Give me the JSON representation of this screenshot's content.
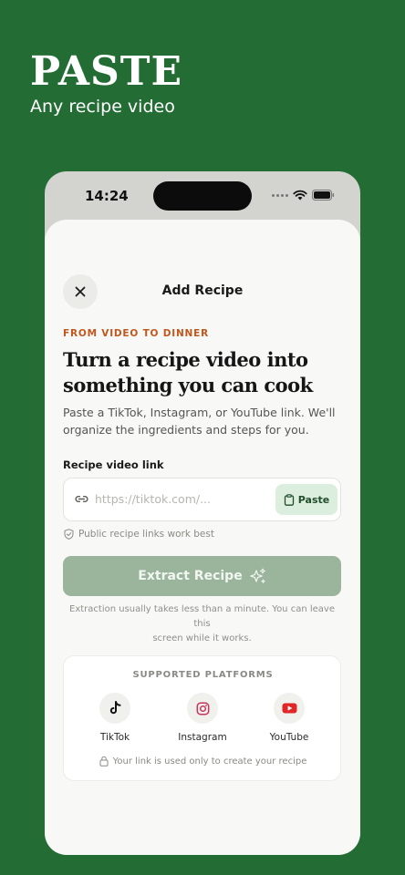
{
  "promo": {
    "title": "PASTE",
    "subtitle": "Any recipe video"
  },
  "status_bar": {
    "time": "14:24",
    "icons": [
      "signal-dots-icon",
      "wifi-icon",
      "battery-icon"
    ]
  },
  "sheet": {
    "title": "Add Recipe",
    "close_icon": "close-icon"
  },
  "intro": {
    "eyebrow": "FROM VIDEO TO DINNER",
    "headline_line1": "Turn a recipe video into",
    "headline_line2": "something you can cook",
    "body_line1": "Paste a TikTok, Instagram, or YouTube link. We'll",
    "body_line2": "organize the ingredients and steps for you."
  },
  "form": {
    "label": "Recipe video link",
    "placeholder": "https://tiktok.com/...",
    "value": "",
    "paste_label": "Paste",
    "hint": "Public recipe links work best",
    "extract_label": "Extract Recipe",
    "note_line1": "Extraction usually takes less than a minute. You can leave this",
    "note_line2": "screen while it works."
  },
  "platforms": {
    "title": "SUPPORTED PLATFORMS",
    "items": [
      {
        "label": "TikTok",
        "icon": "tiktok-icon"
      },
      {
        "label": "Instagram",
        "icon": "instagram-icon"
      },
      {
        "label": "YouTube",
        "icon": "youtube-icon"
      }
    ],
    "privacy": "Your link is used only to create your recipe"
  },
  "colors": {
    "background": "#236d35",
    "accent": "#c2571e",
    "button_disabled": "#9bb59d",
    "paste_bg": "#dceedd"
  }
}
